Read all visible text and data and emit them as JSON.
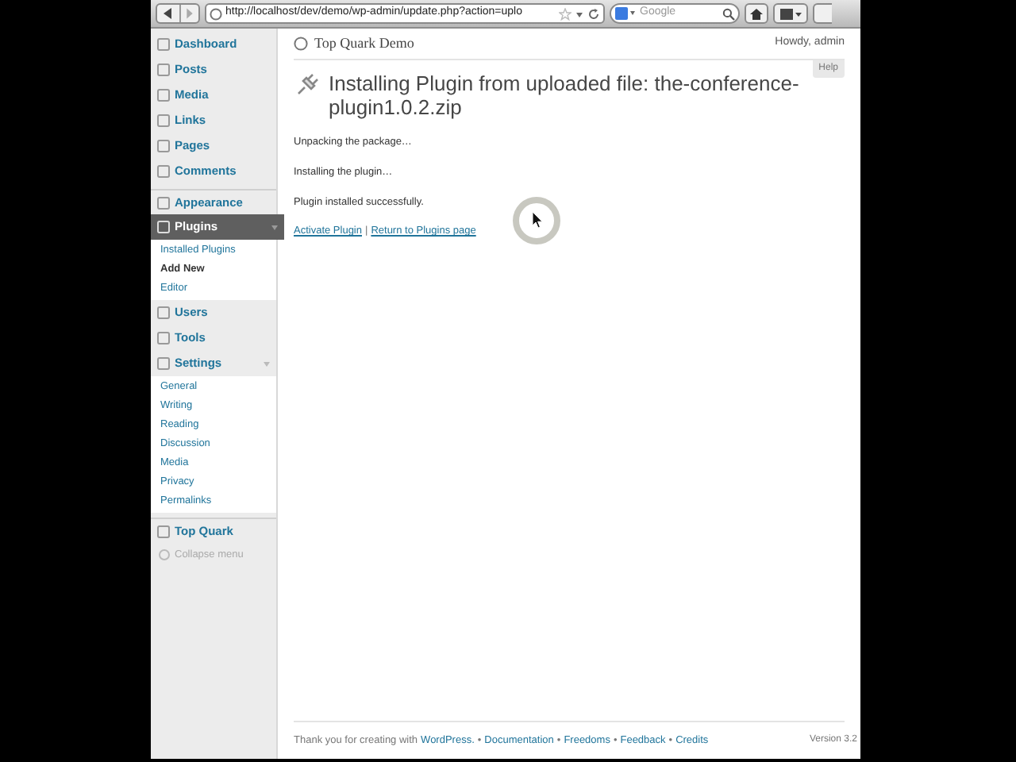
{
  "browser": {
    "url": "http://localhost/dev/demo/wp-admin/update.php?action=uplo",
    "search_placeholder": "Google"
  },
  "sidebar": {
    "items": [
      {
        "label": "Dashboard",
        "selected": false
      },
      {
        "label": "Posts",
        "selected": false
      },
      {
        "label": "Media",
        "selected": false
      },
      {
        "label": "Links",
        "selected": false
      },
      {
        "label": "Pages",
        "selected": false
      },
      {
        "label": "Comments",
        "selected": false
      },
      {
        "label": "Appearance",
        "selected": false
      },
      {
        "label": "Plugins",
        "selected": true,
        "children": [
          {
            "label": "Installed Plugins",
            "selected": false
          },
          {
            "label": "Add New",
            "selected": true
          },
          {
            "label": "Editor",
            "selected": false
          }
        ]
      },
      {
        "label": "Users",
        "selected": false
      },
      {
        "label": "Tools",
        "selected": false
      },
      {
        "label": "Settings",
        "selected": false,
        "children": [
          {
            "label": "General",
            "selected": false
          },
          {
            "label": "Writing",
            "selected": false
          },
          {
            "label": "Reading",
            "selected": false
          },
          {
            "label": "Discussion",
            "selected": false
          },
          {
            "label": "Media",
            "selected": false
          },
          {
            "label": "Privacy",
            "selected": false
          },
          {
            "label": "Permalinks",
            "selected": false
          }
        ]
      },
      {
        "label": "Top Quark",
        "selected": false
      }
    ],
    "collapse": "Collapse menu"
  },
  "header": {
    "site_title": "Top Quark Demo",
    "greeting": "Howdy, admin",
    "help": "Help"
  },
  "page": {
    "title": "Installing Plugin from uploaded file: the-conference-plugin1.0.2.zip",
    "messages": [
      "Unpacking the package…",
      "Installing the plugin…",
      "Plugin installed successfully."
    ],
    "actions": [
      {
        "kind": "link",
        "text": "Activate Plugin"
      },
      {
        "kind": "separator",
        "text": "|"
      },
      {
        "kind": "link",
        "text": "Return to Plugins page"
      }
    ]
  },
  "footer": {
    "items": [
      {
        "kind": "text",
        "text": "Thank you for creating with"
      },
      {
        "kind": "link",
        "text": "WordPress."
      },
      {
        "kind": "separator",
        "text": "•"
      },
      {
        "kind": "link",
        "text": "Documentation"
      },
      {
        "kind": "separator",
        "text": "•"
      },
      {
        "kind": "link",
        "text": "Freedoms"
      },
      {
        "kind": "separator",
        "text": "•"
      },
      {
        "kind": "link",
        "text": "Feedback"
      },
      {
        "kind": "separator",
        "text": "•"
      },
      {
        "kind": "link",
        "text": "Credits"
      }
    ],
    "version": "Version 3.2"
  }
}
